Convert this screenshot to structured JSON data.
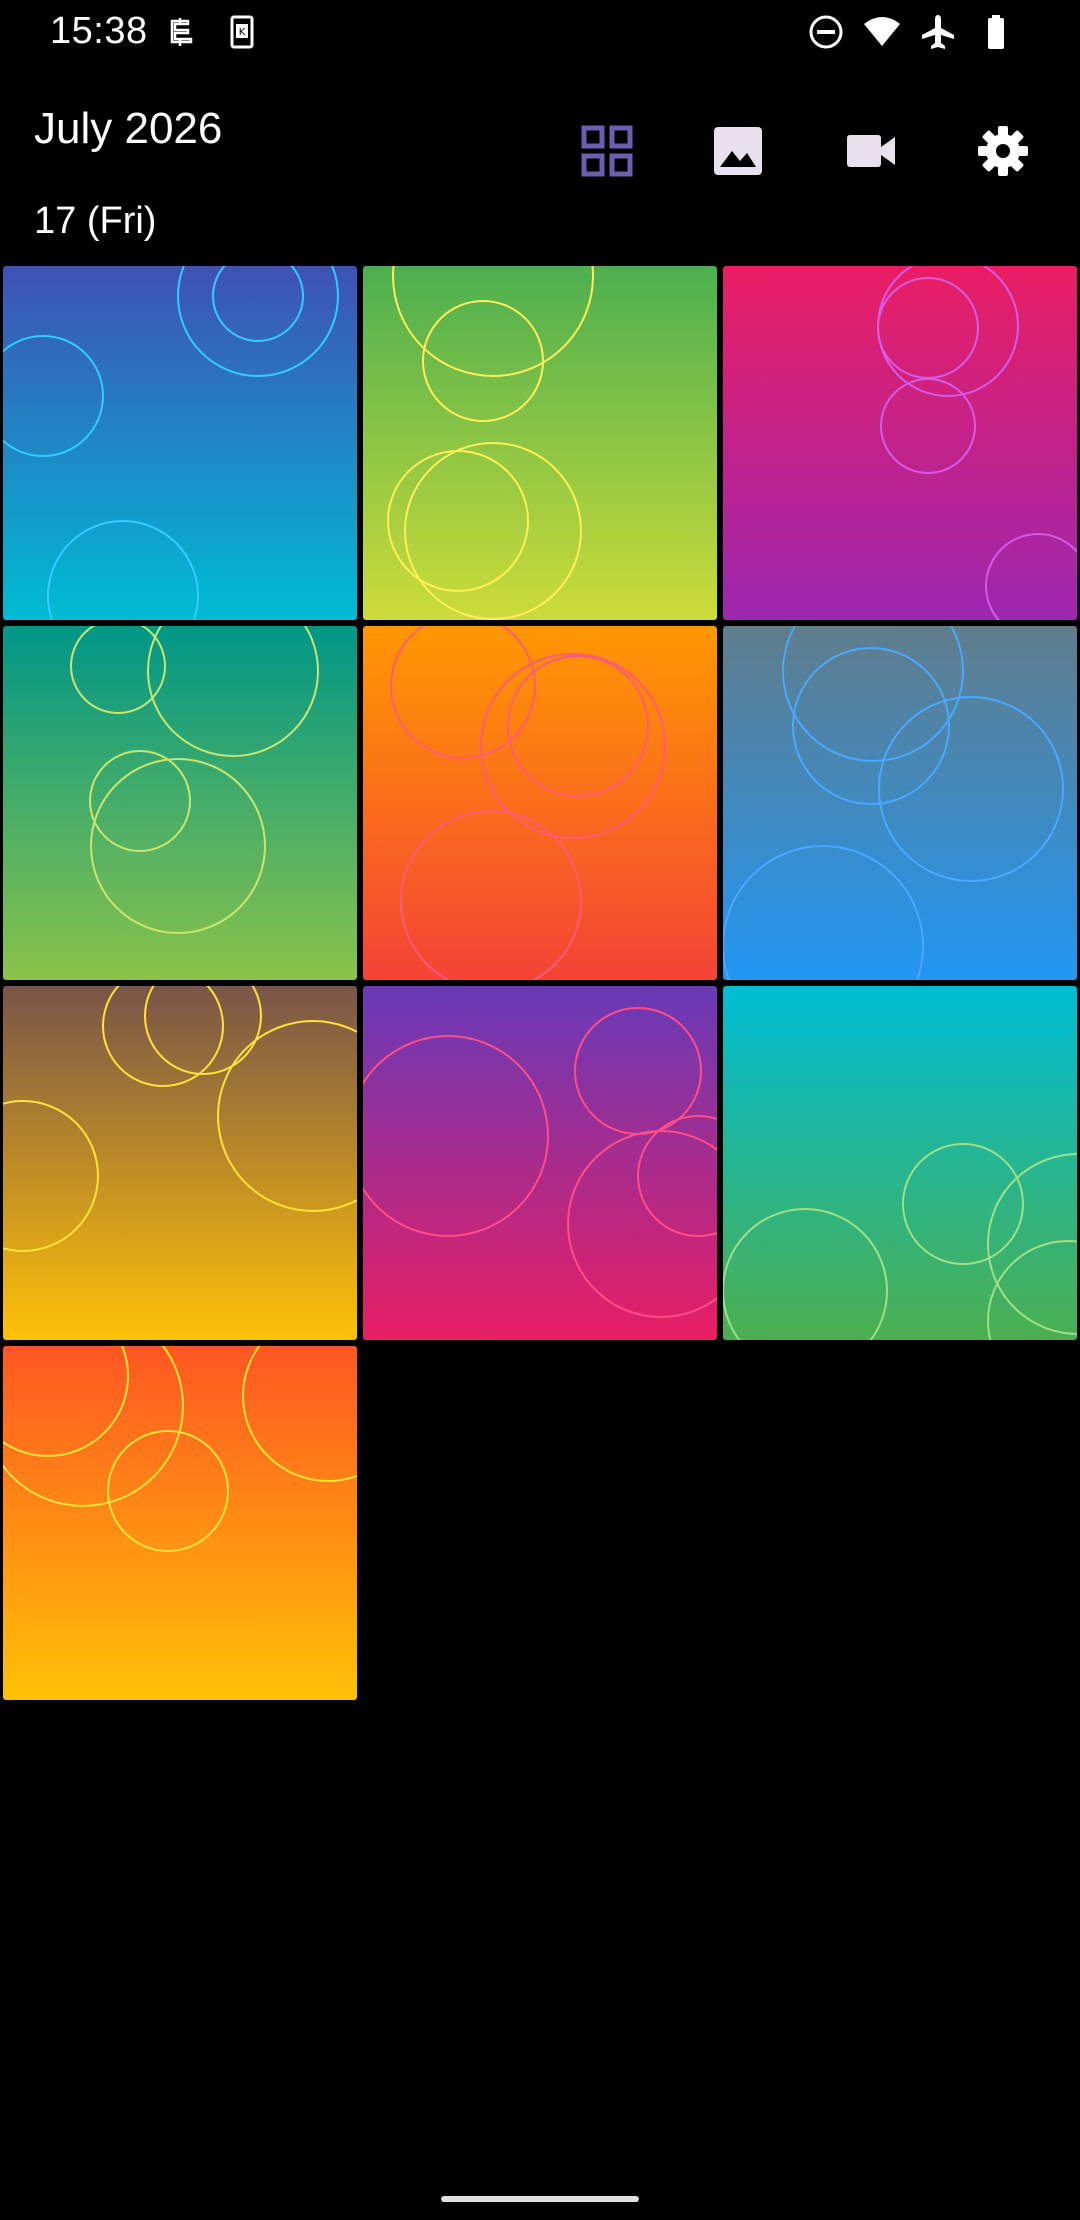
{
  "status_bar": {
    "time": "15:38",
    "left_icons": [
      "sync-icon",
      "sim-card-icon"
    ],
    "right_icons": [
      "do-not-disturb-icon",
      "wifi-icon",
      "airplane-mode-icon",
      "battery-icon"
    ]
  },
  "header": {
    "month": "July 2026",
    "day": "17 (Fri)"
  },
  "toolbar": {
    "items": [
      {
        "name": "grid-view-icon",
        "active": true,
        "color": "#6c5fb0"
      },
      {
        "name": "image-icon",
        "active": false,
        "color": "#e6e1ec"
      },
      {
        "name": "video-icon",
        "active": false,
        "color": "#e6e1ec"
      },
      {
        "name": "settings-icon",
        "active": false,
        "color": "#ffffff"
      }
    ]
  },
  "thumbnails": [
    {
      "top": "#3f51b5",
      "bottom": "#00bcd4",
      "ring": "#33ccff"
    },
    {
      "top": "#4caf50",
      "bottom": "#cddc39",
      "ring": "#ffee58"
    },
    {
      "top": "#e91e63",
      "bottom": "#9c27b0",
      "ring": "#d65ae6"
    },
    {
      "top": "#009688",
      "bottom": "#8bc34a",
      "ring": "#c8e66e"
    },
    {
      "top": "#ff9800",
      "bottom": "#f44336",
      "ring": "#ff5a78"
    },
    {
      "top": "#607d8b",
      "bottom": "#2196f3",
      "ring": "#4aa8ff"
    },
    {
      "top": "#795548",
      "bottom": "#ffc107",
      "ring": "#ffe23a"
    },
    {
      "top": "#673ab7",
      "bottom": "#e91e63",
      "ring": "#ff4d8a"
    },
    {
      "top": "#00bcd4",
      "bottom": "#4caf50",
      "ring": "#9ee08a"
    },
    {
      "top": "#ff5722",
      "bottom": "#ffc107",
      "ring": "#ffe23a"
    }
  ]
}
